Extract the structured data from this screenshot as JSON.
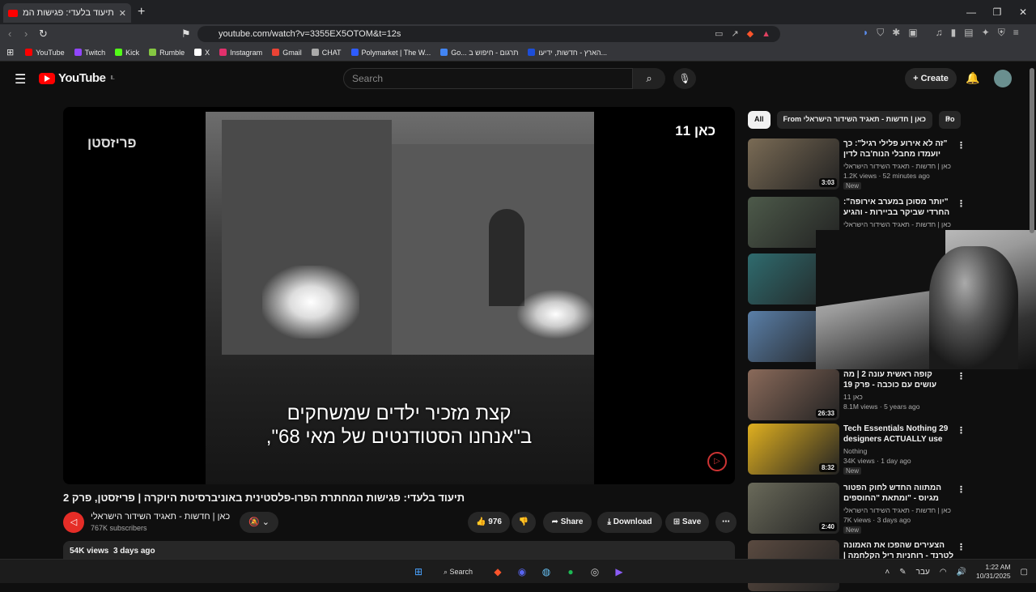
{
  "browser": {
    "tab_title": "תיעוד בלעדי: פגישות המחתרת",
    "tab_close": "✕",
    "new_tab": "+",
    "url": "youtube.com/watch?v=3355EX5OTOM&t=12s",
    "window": {
      "minimize": "—",
      "maximize": "❐",
      "close": "✕"
    }
  },
  "bookmarks": [
    {
      "label": "YouTube",
      "color": "#ff0000"
    },
    {
      "label": "Twitch",
      "color": "#9146ff"
    },
    {
      "label": "Kick",
      "color": "#53fc18"
    },
    {
      "label": "Rumble",
      "color": "#85c742"
    },
    {
      "label": "X",
      "color": "#ffffff"
    },
    {
      "label": "Instagram",
      "color": "#e1306c"
    },
    {
      "label": "Gmail",
      "color": "#ea4335"
    },
    {
      "label": "CHAT",
      "color": "#aaaaaa"
    },
    {
      "label": "Polymarket | The W...",
      "color": "#2e5cff"
    },
    {
      "label": "Go... תרגום - חיפוש ב",
      "color": "#4285f4"
    },
    {
      "label": "הארץ - חדשות, ידיעו...",
      "color": "#1d4ed8"
    }
  ],
  "youtube": {
    "logo_text": "YouTube",
    "region": "IL",
    "search_placeholder": "Search",
    "create_label": "Create"
  },
  "player": {
    "channel_logo": "פריזסטן",
    "kan_logo": "כאן 11",
    "subtitle_line1": "קצת מזכיר ילדים שמשחקים",
    "subtitle_line2": "ב\"אנחנו הסטודנטים של מאי 68\","
  },
  "video": {
    "title": "תיעוד בלעדי: פגישות המחתרת הפרו-פלסטינית באוניברסיטת היוקרה | פריזסטן, פרק 2",
    "channel": "כאן | חדשות - תאגיד השידור הישראלי",
    "subscribers": "767K subscribers",
    "likes": "976",
    "share": "Share",
    "download": "Download",
    "save": "Save",
    "views": "54K views",
    "age": "3 days ago"
  },
  "chips": [
    "All",
    "From כאן | חדשות - תאגיד השידור הישראלי",
    "Po"
  ],
  "recommendations": [
    {
      "title": "\"זה לא אירוע פלילי רגיל\": כך יועמדו מחבלי הנוח'בה לדין",
      "channel": "כאן | חדשות - תאגיד השידור הישראלי",
      "meta": "1.2K views · 52 minutes ago",
      "badge": "New",
      "duration": "3:03",
      "color": "#7a6b55"
    },
    {
      "title": "\"יותר מסוכן במערב אירופה\": החרדי שביקר בביירות - והגיע ללב הדאחייה",
      "channel": "כאן | חדשות - תאגיד השידור הישראלי",
      "meta": "",
      "badge": "",
      "duration": "",
      "color": "#4d5a4a"
    },
    {
      "title": "",
      "channel": "",
      "meta": "",
      "badge": "",
      "duration": "",
      "color": "#2f6b6e"
    },
    {
      "title": "",
      "channel": "",
      "meta": "",
      "badge": "",
      "duration": "",
      "color": "#5a7fa8"
    },
    {
      "title": "קופה ראשית עונה 2 | מה עושים עם כוכבה - פרק 19",
      "channel": "כאן 11",
      "meta": "8.1M views · 5 years ago",
      "badge": "",
      "duration": "26:33",
      "color": "#8a6a5a"
    },
    {
      "title": "29 Tech Essentials Nothing designers ACTUALLY use",
      "channel": "Nothing",
      "meta": "34K views · 1 day ago",
      "badge": "New",
      "duration": "8:32",
      "color": "#e0b020"
    },
    {
      "title": "המתווה החדש לחוק הפטור מגיוס - \"ומתאת \"החוספים החרדים...",
      "channel": "כאן | חדשות - תאגיד השידור הישראלי",
      "meta": "7K views · 3 days ago",
      "badge": "New",
      "duration": "2:40",
      "color": "#6a6a5a"
    },
    {
      "title": "הצעירים שהפכו את האמונה לטרנד - רוחניות ריל הקלחמה | אלוהים",
      "channel": "",
      "meta": "",
      "badge": "",
      "duration": "",
      "color": "#5a4a40"
    }
  ],
  "taskbar": {
    "search_label": "Search",
    "lang": "עבר",
    "time": "1:22 AM",
    "date": "10/31/2025"
  }
}
